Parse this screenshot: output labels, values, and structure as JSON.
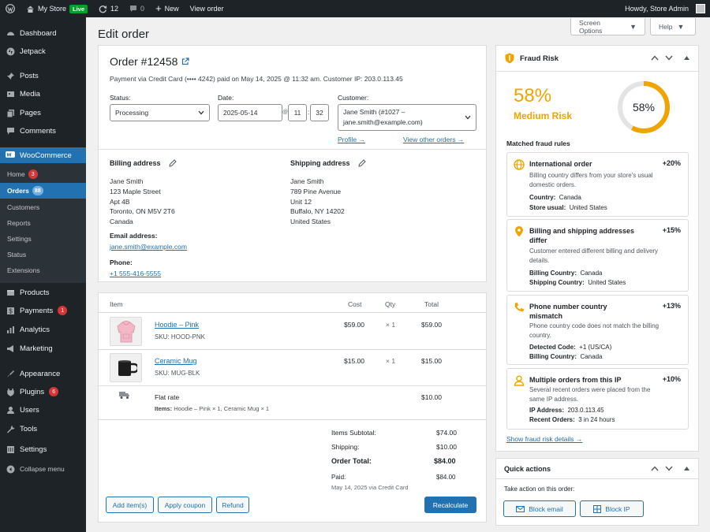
{
  "adminbar": {
    "store_name": "My Store",
    "live": "Live",
    "updates": "12",
    "comments": "0",
    "new": "New",
    "view_order": "View order",
    "howdy": "Howdy, Store Admin"
  },
  "sidebar": {
    "items": [
      {
        "label": "Dashboard",
        "icon": "dashboard-icon"
      },
      {
        "label": "Jetpack",
        "icon": "jetpack-icon"
      },
      {
        "label": "Posts",
        "icon": "pin-icon"
      },
      {
        "label": "Media",
        "icon": "media-icon"
      },
      {
        "label": "Pages",
        "icon": "pages-icon"
      },
      {
        "label": "Comments",
        "icon": "comments-icon"
      },
      {
        "label": "WooCommerce",
        "icon": "woo-icon"
      },
      {
        "label": "Products",
        "icon": "products-icon"
      },
      {
        "label": "Payments",
        "icon": "payments-icon",
        "badge": "1"
      },
      {
        "label": "Analytics",
        "icon": "analytics-icon"
      },
      {
        "label": "Marketing",
        "icon": "megaphone-icon"
      },
      {
        "label": "Appearance",
        "icon": "brush-icon"
      },
      {
        "label": "Plugins",
        "icon": "plugin-icon",
        "badge": "6"
      },
      {
        "label": "Users",
        "icon": "user-icon"
      },
      {
        "label": "Tools",
        "icon": "wrench-icon"
      },
      {
        "label": "Settings",
        "icon": "settings-icon"
      },
      {
        "label": "Collapse menu",
        "icon": "collapse-icon"
      }
    ],
    "woo_sub": [
      {
        "label": "Home",
        "badge": "3"
      },
      {
        "label": "Orders",
        "badge": "88"
      },
      {
        "label": "Customers"
      },
      {
        "label": "Reports"
      },
      {
        "label": "Settings"
      },
      {
        "label": "Status"
      },
      {
        "label": "Extensions"
      }
    ]
  },
  "page": {
    "title": "Edit order",
    "screen_options": "Screen Options",
    "help": "Help"
  },
  "order": {
    "title": "Order #12458",
    "meta": "Payment via Credit Card (•••• 4242) paid on May 14, 2025 @ 11:32 am. Customer IP: 203.0.113.45",
    "status_label": "Status:",
    "status_value": "Processing",
    "date_label": "Date:",
    "date_value": "2025-05-14",
    "at": "@",
    "hour": "11",
    "minute": "32",
    "colon": ":",
    "customer_label": "Customer:",
    "customer_line1": "Jane Smith (#1027 –",
    "customer_line2": "jane.smith@example.com)",
    "profile_link": "Profile →",
    "other_orders_link": "View other orders →",
    "billing": {
      "heading": "Billing address",
      "lines": [
        "Jane Smith",
        "123 Maple Street",
        "Apt 4B",
        "Toronto, ON M5V 2T6",
        "Canada"
      ],
      "email_label": "Email address:",
      "email": "jane.smith@example.com",
      "phone_label": "Phone:",
      "phone": "+1 555-416-5555"
    },
    "shipping": {
      "heading": "Shipping address",
      "lines": [
        "Jane Smith",
        "789 Pine Avenue",
        "Unit 12",
        "Buffalo, NY 14202",
        "United States"
      ]
    }
  },
  "items": {
    "headers": {
      "item": "Item",
      "cost": "Cost",
      "qty": "Qty",
      "total": "Total"
    },
    "rows": [
      {
        "name": "Hoodie – Pink",
        "sku": "SKU: HOOD-PNK",
        "cost": "$59.00",
        "qty": "× 1",
        "total": "$59.00",
        "thumb": "hoodie-image"
      },
      {
        "name": "Ceramic Mug",
        "sku": "SKU: MUG-BLK",
        "cost": "$15.00",
        "qty": "× 1",
        "total": "$15.00",
        "thumb": "mug-image"
      }
    ],
    "shipping_row": {
      "name": "Flat rate",
      "items_label": "Items:",
      "items": "Hoodie – Pink × 1, Ceramic Mug × 1",
      "total": "$10.00"
    },
    "totals": {
      "subtotal_label": "Items Subtotal:",
      "subtotal": "$74.00",
      "shipping_label": "Shipping:",
      "shipping": "$10.00",
      "total_label": "Order Total:",
      "total": "$84.00",
      "paid_label": "Paid:",
      "paid": "$84.00",
      "paid_note": "May 14, 2025 via Credit Card"
    },
    "buttons": {
      "add_items": "Add item(s)",
      "apply_coupon": "Apply coupon",
      "refund": "Refund",
      "recalculate": "Recalculate"
    }
  },
  "fraud": {
    "title": "Fraud Risk",
    "percent": "58%",
    "level": "Medium Risk",
    "gauge_value": 0.58,
    "accent": "#f0a400",
    "matched_title": "Matched fraud rules",
    "rules": [
      {
        "title": "International order",
        "points": "+20%",
        "desc": "Billing country differs from your store's usual domestic orders.",
        "icon": "globe-icon",
        "kv": [
          [
            "Country:",
            "Canada"
          ],
          [
            "Store usual:",
            "United States"
          ]
        ]
      },
      {
        "title": "Billing and shipping addresses differ",
        "points": "+15%",
        "desc": "Customer entered different billing and delivery details.",
        "icon": "location-pin-icon",
        "kv": [
          [
            "Billing Country:",
            "Canada"
          ],
          [
            "Shipping Country:",
            "United States"
          ]
        ]
      },
      {
        "title": "Phone number country mismatch",
        "points": "+13%",
        "desc": "Phone country code does not match the billing country.",
        "icon": "phone-icon",
        "kv": [
          [
            "Detected Code:",
            "+1 (US/CA)"
          ],
          [
            "Billing Country:",
            "Canada"
          ]
        ]
      },
      {
        "title": "Multiple orders from this IP",
        "points": "+10%",
        "desc": "Several recent orders were placed from the same IP address.",
        "icon": "person-icon",
        "kv": [
          [
            "IP Address:",
            "203.0.113.45"
          ],
          [
            "Recent Orders:",
            "3 in 24 hours"
          ]
        ]
      }
    ],
    "details_link": "Show fraud risk details →"
  },
  "quick": {
    "title": "Quick actions",
    "subtitle": "Take action on this order:",
    "block_email": "Block email",
    "block_ip": "Block IP"
  }
}
